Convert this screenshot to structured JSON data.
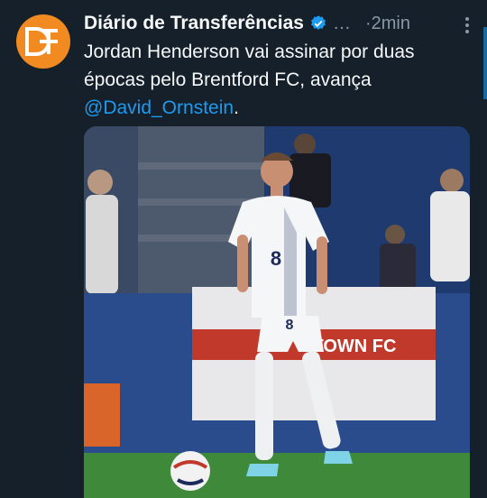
{
  "account": {
    "name": "Diário de Transferências",
    "handle": "…",
    "time": "·2min",
    "avatar_letters": "DT",
    "avatar_color": "#f28a22",
    "verified_icon": "verified-badge-icon"
  },
  "tweet": {
    "text_before": "Jordan Henderson vai assinar por duas épocas pelo Brentford FC, avança ",
    "mention": "@David_Ornstein",
    "text_after": "."
  },
  "media": {
    "jersey_number": "8",
    "banner_text": "TOWN FC"
  },
  "colors": {
    "background": "#15202b",
    "link": "#1d9bf0",
    "secondary_text": "#8b98a5"
  }
}
